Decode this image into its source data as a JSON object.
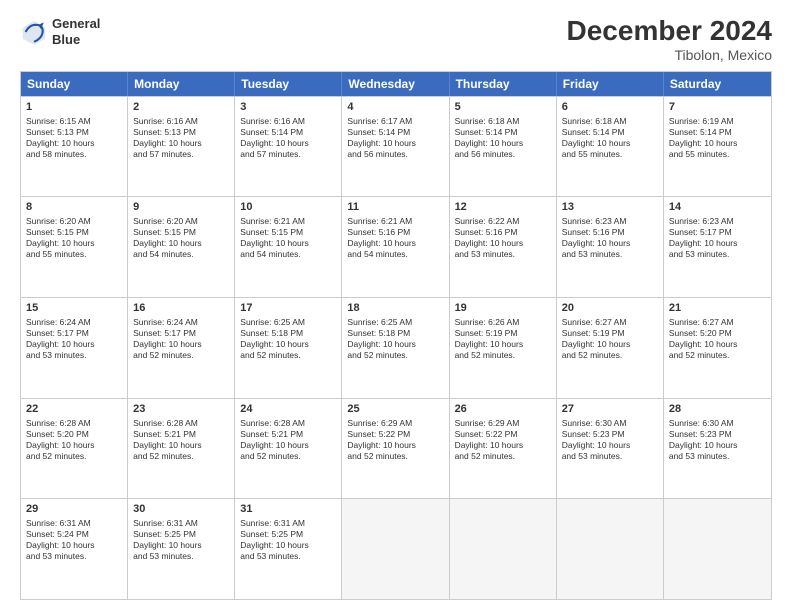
{
  "header": {
    "logo_line1": "General",
    "logo_line2": "Blue",
    "title": "December 2024",
    "subtitle": "Tibolon, Mexico"
  },
  "days_of_week": [
    "Sunday",
    "Monday",
    "Tuesday",
    "Wednesday",
    "Thursday",
    "Friday",
    "Saturday"
  ],
  "weeks": [
    [
      {
        "day": "1",
        "info": "Sunrise: 6:15 AM\nSunset: 5:13 PM\nDaylight: 10 hours\nand 58 minutes."
      },
      {
        "day": "2",
        "info": "Sunrise: 6:16 AM\nSunset: 5:13 PM\nDaylight: 10 hours\nand 57 minutes."
      },
      {
        "day": "3",
        "info": "Sunrise: 6:16 AM\nSunset: 5:14 PM\nDaylight: 10 hours\nand 57 minutes."
      },
      {
        "day": "4",
        "info": "Sunrise: 6:17 AM\nSunset: 5:14 PM\nDaylight: 10 hours\nand 56 minutes."
      },
      {
        "day": "5",
        "info": "Sunrise: 6:18 AM\nSunset: 5:14 PM\nDaylight: 10 hours\nand 56 minutes."
      },
      {
        "day": "6",
        "info": "Sunrise: 6:18 AM\nSunset: 5:14 PM\nDaylight: 10 hours\nand 55 minutes."
      },
      {
        "day": "7",
        "info": "Sunrise: 6:19 AM\nSunset: 5:14 PM\nDaylight: 10 hours\nand 55 minutes."
      }
    ],
    [
      {
        "day": "8",
        "info": "Sunrise: 6:20 AM\nSunset: 5:15 PM\nDaylight: 10 hours\nand 55 minutes."
      },
      {
        "day": "9",
        "info": "Sunrise: 6:20 AM\nSunset: 5:15 PM\nDaylight: 10 hours\nand 54 minutes."
      },
      {
        "day": "10",
        "info": "Sunrise: 6:21 AM\nSunset: 5:15 PM\nDaylight: 10 hours\nand 54 minutes."
      },
      {
        "day": "11",
        "info": "Sunrise: 6:21 AM\nSunset: 5:16 PM\nDaylight: 10 hours\nand 54 minutes."
      },
      {
        "day": "12",
        "info": "Sunrise: 6:22 AM\nSunset: 5:16 PM\nDaylight: 10 hours\nand 53 minutes."
      },
      {
        "day": "13",
        "info": "Sunrise: 6:23 AM\nSunset: 5:16 PM\nDaylight: 10 hours\nand 53 minutes."
      },
      {
        "day": "14",
        "info": "Sunrise: 6:23 AM\nSunset: 5:17 PM\nDaylight: 10 hours\nand 53 minutes."
      }
    ],
    [
      {
        "day": "15",
        "info": "Sunrise: 6:24 AM\nSunset: 5:17 PM\nDaylight: 10 hours\nand 53 minutes."
      },
      {
        "day": "16",
        "info": "Sunrise: 6:24 AM\nSunset: 5:17 PM\nDaylight: 10 hours\nand 52 minutes."
      },
      {
        "day": "17",
        "info": "Sunrise: 6:25 AM\nSunset: 5:18 PM\nDaylight: 10 hours\nand 52 minutes."
      },
      {
        "day": "18",
        "info": "Sunrise: 6:25 AM\nSunset: 5:18 PM\nDaylight: 10 hours\nand 52 minutes."
      },
      {
        "day": "19",
        "info": "Sunrise: 6:26 AM\nSunset: 5:19 PM\nDaylight: 10 hours\nand 52 minutes."
      },
      {
        "day": "20",
        "info": "Sunrise: 6:27 AM\nSunset: 5:19 PM\nDaylight: 10 hours\nand 52 minutes."
      },
      {
        "day": "21",
        "info": "Sunrise: 6:27 AM\nSunset: 5:20 PM\nDaylight: 10 hours\nand 52 minutes."
      }
    ],
    [
      {
        "day": "22",
        "info": "Sunrise: 6:28 AM\nSunset: 5:20 PM\nDaylight: 10 hours\nand 52 minutes."
      },
      {
        "day": "23",
        "info": "Sunrise: 6:28 AM\nSunset: 5:21 PM\nDaylight: 10 hours\nand 52 minutes."
      },
      {
        "day": "24",
        "info": "Sunrise: 6:28 AM\nSunset: 5:21 PM\nDaylight: 10 hours\nand 52 minutes."
      },
      {
        "day": "25",
        "info": "Sunrise: 6:29 AM\nSunset: 5:22 PM\nDaylight: 10 hours\nand 52 minutes."
      },
      {
        "day": "26",
        "info": "Sunrise: 6:29 AM\nSunset: 5:22 PM\nDaylight: 10 hours\nand 52 minutes."
      },
      {
        "day": "27",
        "info": "Sunrise: 6:30 AM\nSunset: 5:23 PM\nDaylight: 10 hours\nand 53 minutes."
      },
      {
        "day": "28",
        "info": "Sunrise: 6:30 AM\nSunset: 5:23 PM\nDaylight: 10 hours\nand 53 minutes."
      }
    ],
    [
      {
        "day": "29",
        "info": "Sunrise: 6:31 AM\nSunset: 5:24 PM\nDaylight: 10 hours\nand 53 minutes."
      },
      {
        "day": "30",
        "info": "Sunrise: 6:31 AM\nSunset: 5:25 PM\nDaylight: 10 hours\nand 53 minutes."
      },
      {
        "day": "31",
        "info": "Sunrise: 6:31 AM\nSunset: 5:25 PM\nDaylight: 10 hours\nand 53 minutes."
      },
      {
        "day": "",
        "info": ""
      },
      {
        "day": "",
        "info": ""
      },
      {
        "day": "",
        "info": ""
      },
      {
        "day": "",
        "info": ""
      }
    ]
  ]
}
